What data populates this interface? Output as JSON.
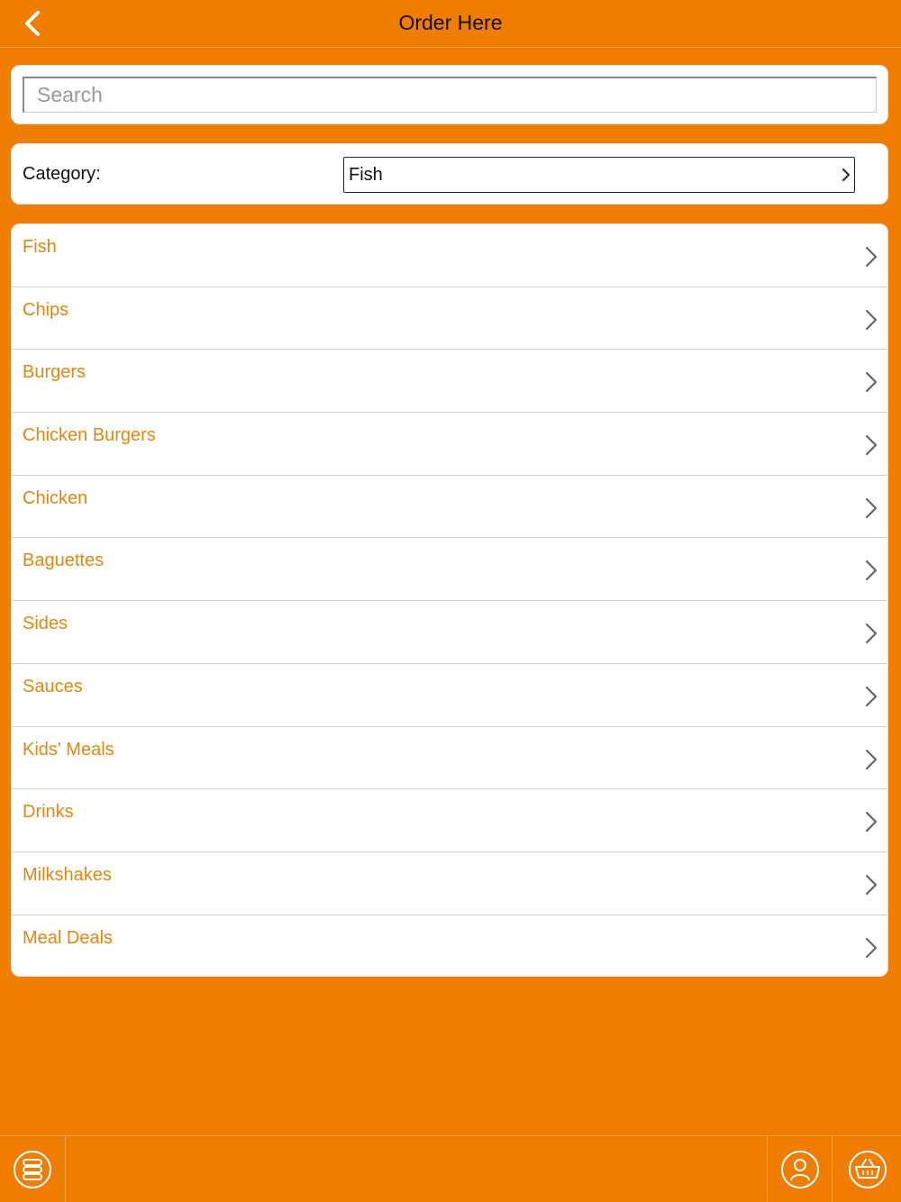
{
  "header": {
    "title": "Order Here",
    "back_icon": "chevron-left-icon"
  },
  "search": {
    "placeholder": "Search",
    "value": ""
  },
  "category": {
    "label": "Category:",
    "selected": "Fish"
  },
  "menu_items": [
    {
      "label": "Fish"
    },
    {
      "label": "Chips"
    },
    {
      "label": "Burgers"
    },
    {
      "label": "Chicken Burgers"
    },
    {
      "label": "Chicken"
    },
    {
      "label": "Baguettes"
    },
    {
      "label": "Sides"
    },
    {
      "label": "Sauces"
    },
    {
      "label": "Kids' Meals"
    },
    {
      "label": "Drinks"
    },
    {
      "label": "Milkshakes"
    },
    {
      "label": "Meal Deals"
    }
  ],
  "bottom_bar": {
    "left_icon": "menu-stack-icon",
    "account_icon": "user-icon",
    "basket_icon": "basket-icon"
  },
  "colors": {
    "background": "#EF7D00",
    "item_text": "#E2870F",
    "card": "#FFFFFF"
  }
}
